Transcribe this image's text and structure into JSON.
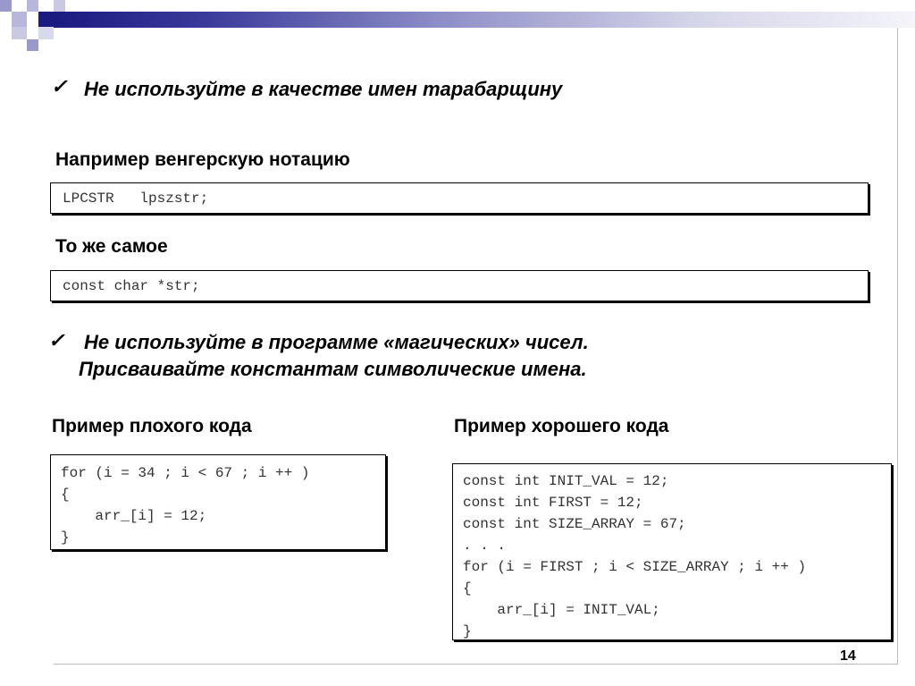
{
  "bullets": [
    {
      "check": "✓",
      "text": "Не используйте в качестве имен тарабарщину"
    },
    {
      "check": "✓",
      "line1": "Не используйте в программе «магических» чисел.",
      "line2": "Присваивайте константам символические имена."
    }
  ],
  "section_hungarian": {
    "label": "Например венгерскую нотацию",
    "code": [
      "LPCSTR   lpszstr;"
    ]
  },
  "section_same": {
    "label": "То же самое",
    "code": [
      "const char *str;"
    ]
  },
  "bad_example": {
    "label": "Пример плохого кода",
    "code": [
      "for (i = 34 ; i < 67 ; i ++ )",
      "{",
      "    arr_[i] = 12;",
      "}"
    ]
  },
  "good_example": {
    "label": "Пример хорошего кода",
    "code": [
      "const int INIT_VAL = 12;",
      "const int FIRST = 12;",
      "const int SIZE_ARRAY = 67;",
      ". . .",
      "for (i = FIRST ; i < SIZE_ARRAY ; i ++ )",
      "{",
      "    arr_[i] = INIT_VAL;",
      "}"
    ]
  },
  "slide_number": "14",
  "colors": {
    "header_dark": "#1a1a80",
    "header_squares": "#9999cc",
    "code_text": "#333333"
  }
}
